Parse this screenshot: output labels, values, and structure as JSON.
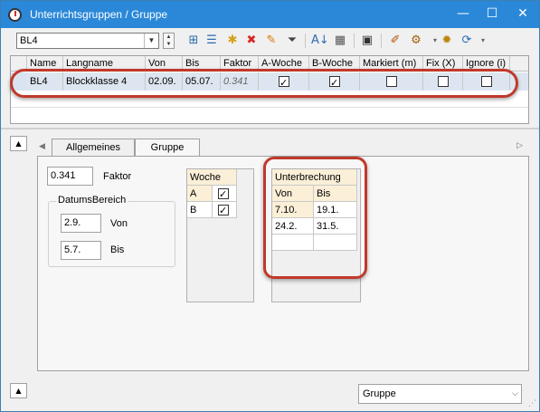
{
  "window": {
    "title": "Unterrichtsgruppen / Gruppe",
    "minimize": "—",
    "maximize": "☐",
    "close": "✕"
  },
  "toolbar": {
    "group_value": "BL4",
    "icons": [
      "new-row-icon",
      "list-icon",
      "new-doc-icon",
      "delete-icon",
      "edit-icon",
      "filter-icon",
      "sort-icon",
      "grid-icon",
      "calendar-icon",
      "tools-icon",
      "settings-icon",
      "gear-icon",
      "refresh-icon"
    ]
  },
  "grid": {
    "columns": [
      "Name",
      "Langname",
      "Von",
      "Bis",
      "Faktor",
      "A-Woche",
      "B-Woche",
      "Markiert (m)",
      "Fix (X)",
      "Ignore (i)"
    ],
    "rows": [
      {
        "name": "BL4",
        "langname": "Blockklasse 4",
        "von": "02.09.",
        "bis": "05.07.",
        "faktor": "0.341",
        "a_woche": true,
        "b_woche": true,
        "markiert": false,
        "fix": false,
        "ignore": false
      }
    ]
  },
  "tabs": {
    "items": [
      "Allgemeines",
      "Gruppe"
    ],
    "active": "Gruppe",
    "left_arrow": "◀",
    "right_arrow": "▷"
  },
  "form": {
    "faktor_value": "0.341",
    "faktor_label": "Faktor",
    "datumsbereich_title": "DatumsBereich",
    "von_value": "2.9.",
    "von_label": "Von",
    "bis_value": "5.7.",
    "bis_label": "Bis"
  },
  "woche_table": {
    "header": "Woche",
    "rows": [
      {
        "label": "A",
        "checked": true
      },
      {
        "label": "B",
        "checked": true
      }
    ]
  },
  "unterbrechung_table": {
    "header": "Unterbrechung",
    "columns": [
      "Von",
      "Bis"
    ],
    "rows": [
      [
        "7.10.",
        "19.1."
      ],
      [
        "24.2.",
        "31.5."
      ]
    ]
  },
  "bottom": {
    "collapse_symbol": "▲",
    "view_select": "Gruppe",
    "dropdown_symbol": "⌵"
  },
  "colors": {
    "titlebar": "#2b88d8",
    "annotation_red": "#c0392b",
    "selected_row": "#dde6f0",
    "table_header": "#fbefd8"
  }
}
